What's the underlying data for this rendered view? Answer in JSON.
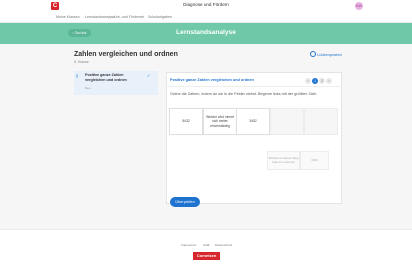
{
  "app": {
    "logo_letter": "C",
    "title": "Diagnose und Fördern",
    "avatar_initials": "KW"
  },
  "subnav": {
    "items": [
      "Meine Klassen",
      "Lernstandsanalyse",
      "Unt.-und Förderset",
      "Schulaufgaben"
    ]
  },
  "banner": {
    "back_label": "Zurück",
    "title": "Lernstandsanalyse"
  },
  "page": {
    "heading": "Zahlen vergleichen und ordnen",
    "subheading": "5. Klasse",
    "gaps_link": "Lückenposten"
  },
  "sidebar": {
    "item_icon": "§",
    "item_title": "Positive ganze Zahlen vergleichen und ordnen",
    "item_status": "Neu",
    "item_check": "✓"
  },
  "card": {
    "title": "Positive ganze Zahlen vergleichen und ordnen",
    "pager": [
      "‹",
      "1",
      "2",
      "›"
    ],
    "instruction": "Ordne die Zahlen, indem du sie in die Felder ziehst. Beginne links mit der größten Zahl.",
    "slots": [
      "5432",
      "Welche wird nimmt sich weiter einverständig",
      "3452",
      "",
      ""
    ],
    "tiles": [
      "Welche ist dieser Weg Das ist so Einzig",
      "3452"
    ],
    "check_button": "Überprüfen"
  },
  "footer": {
    "links": [
      "Impressum",
      "AGB",
      "Datenschutz"
    ],
    "brand": "Cornelsen"
  },
  "colors": {
    "accent": "#1e73d1",
    "banner": "#6fc9a9",
    "brand": "#d6272c"
  }
}
